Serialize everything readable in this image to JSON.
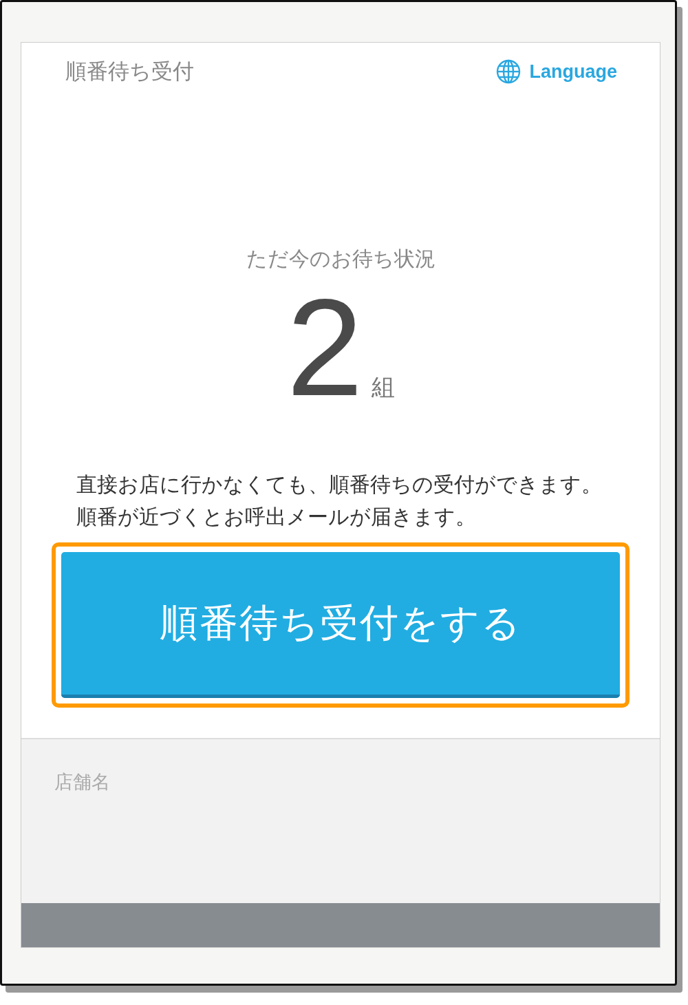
{
  "header": {
    "title": "順番待ち受付",
    "language_link": "Language"
  },
  "status": {
    "heading": "ただ今のお待ち状況",
    "count": "2",
    "unit": "組"
  },
  "description": "直接お店に行かなくても、順番待ちの受付ができます。順番が近づくとお呼出メールが届きます。",
  "primary_button": {
    "label": "順番待ち受付をする",
    "highlighted": true
  },
  "store": {
    "label": "店舗名"
  }
}
